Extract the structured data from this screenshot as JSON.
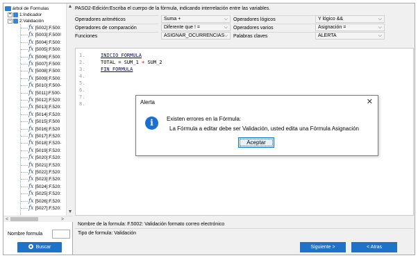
{
  "tree": {
    "root_label": "árbol de Formulas",
    "indicador_label": "1:Indicador",
    "validacion_label": "2:Validación",
    "items": [
      "[5002]:F.500:",
      "[5003]:F.500!",
      "[5004]:F.500:",
      "[5005]:F.500:",
      "[5006]:F.500:",
      "[5007]:F.500:",
      "[5008]:F.500:",
      "[5009]:F.500:",
      "[5010]:F.500-",
      "[5011]:F.500-",
      "[5012]:F.520:",
      "[5013]:F.520:",
      "[5014]:F.520:",
      "[5015]:F.500",
      "[5016]:F.520",
      "[5017]:F.520:",
      "[5018]:F.520-",
      "[5019]:F.520:",
      "[5020]:F.520:",
      "[5021]:F.520:",
      "[5022]:F.520:",
      "[5023]:F.520:",
      "[5024]:F.520:",
      "[5025]:F.520:",
      "[5026]:F.520:",
      "[5027]:F.520:"
    ]
  },
  "left_bottom": {
    "nombre_label": "Nombre formula",
    "buscar_label": "Buscar"
  },
  "header": {
    "title": "PASO2-Edición:Escriba el cuerpo de la fórmula, indicando interrelación entre las variables."
  },
  "grid": {
    "row1": {
      "label1": "Operadores aritméticos",
      "combo1": "Suma +",
      "label2": "Operadores lógicos",
      "combo2": "Y lógico &&"
    },
    "row2": {
      "label1": "Operadores de comparación",
      "combo1": "Diferente que ! =",
      "label2": "Operadores varios",
      "combo2": "Asignación ="
    },
    "row3": {
      "label1": "Funciones",
      "combo1": "ASIGNAR_OCURRENCIAS",
      "label2": "Palabras claves",
      "combo2": "ALERTA"
    }
  },
  "editor": {
    "line_numbers": [
      "1.",
      "2.",
      "3.",
      "4.",
      "5.",
      "6.",
      "7.",
      "8."
    ],
    "line1_kw": "INICIO_FORMULA",
    "line2_a": "TOTAL = SUM_1",
    "line2_op": "+",
    "line2_b": "SUM_2",
    "line3_kw": "FIN_FORMULA"
  },
  "footer": {
    "nombre": "Nombre de la formula: F.5002: Validación formato correo electrónico",
    "tipo": "Tipo de formula: Validación",
    "siguiente": "Siguiente >",
    "atras": "< Atras"
  },
  "dialog": {
    "title": "Alerta",
    "close": "✕",
    "icon": "i",
    "msg1": "Existen errores en la Fórmula:",
    "msg2": "La Fórmula a editar debe ser Validación, usted edita una Fórmula Asignación",
    "ok": "Aceptar"
  },
  "icons": {
    "combo_chevron": "⌵",
    "scroll_up": "▲",
    "scroll_down": "▼",
    "scroll_left": "<",
    "scroll_right": ">",
    "fx": "fx"
  },
  "colors": {
    "accent": "#1e72c8",
    "keyword": "#000080",
    "operator": "#c00000"
  }
}
